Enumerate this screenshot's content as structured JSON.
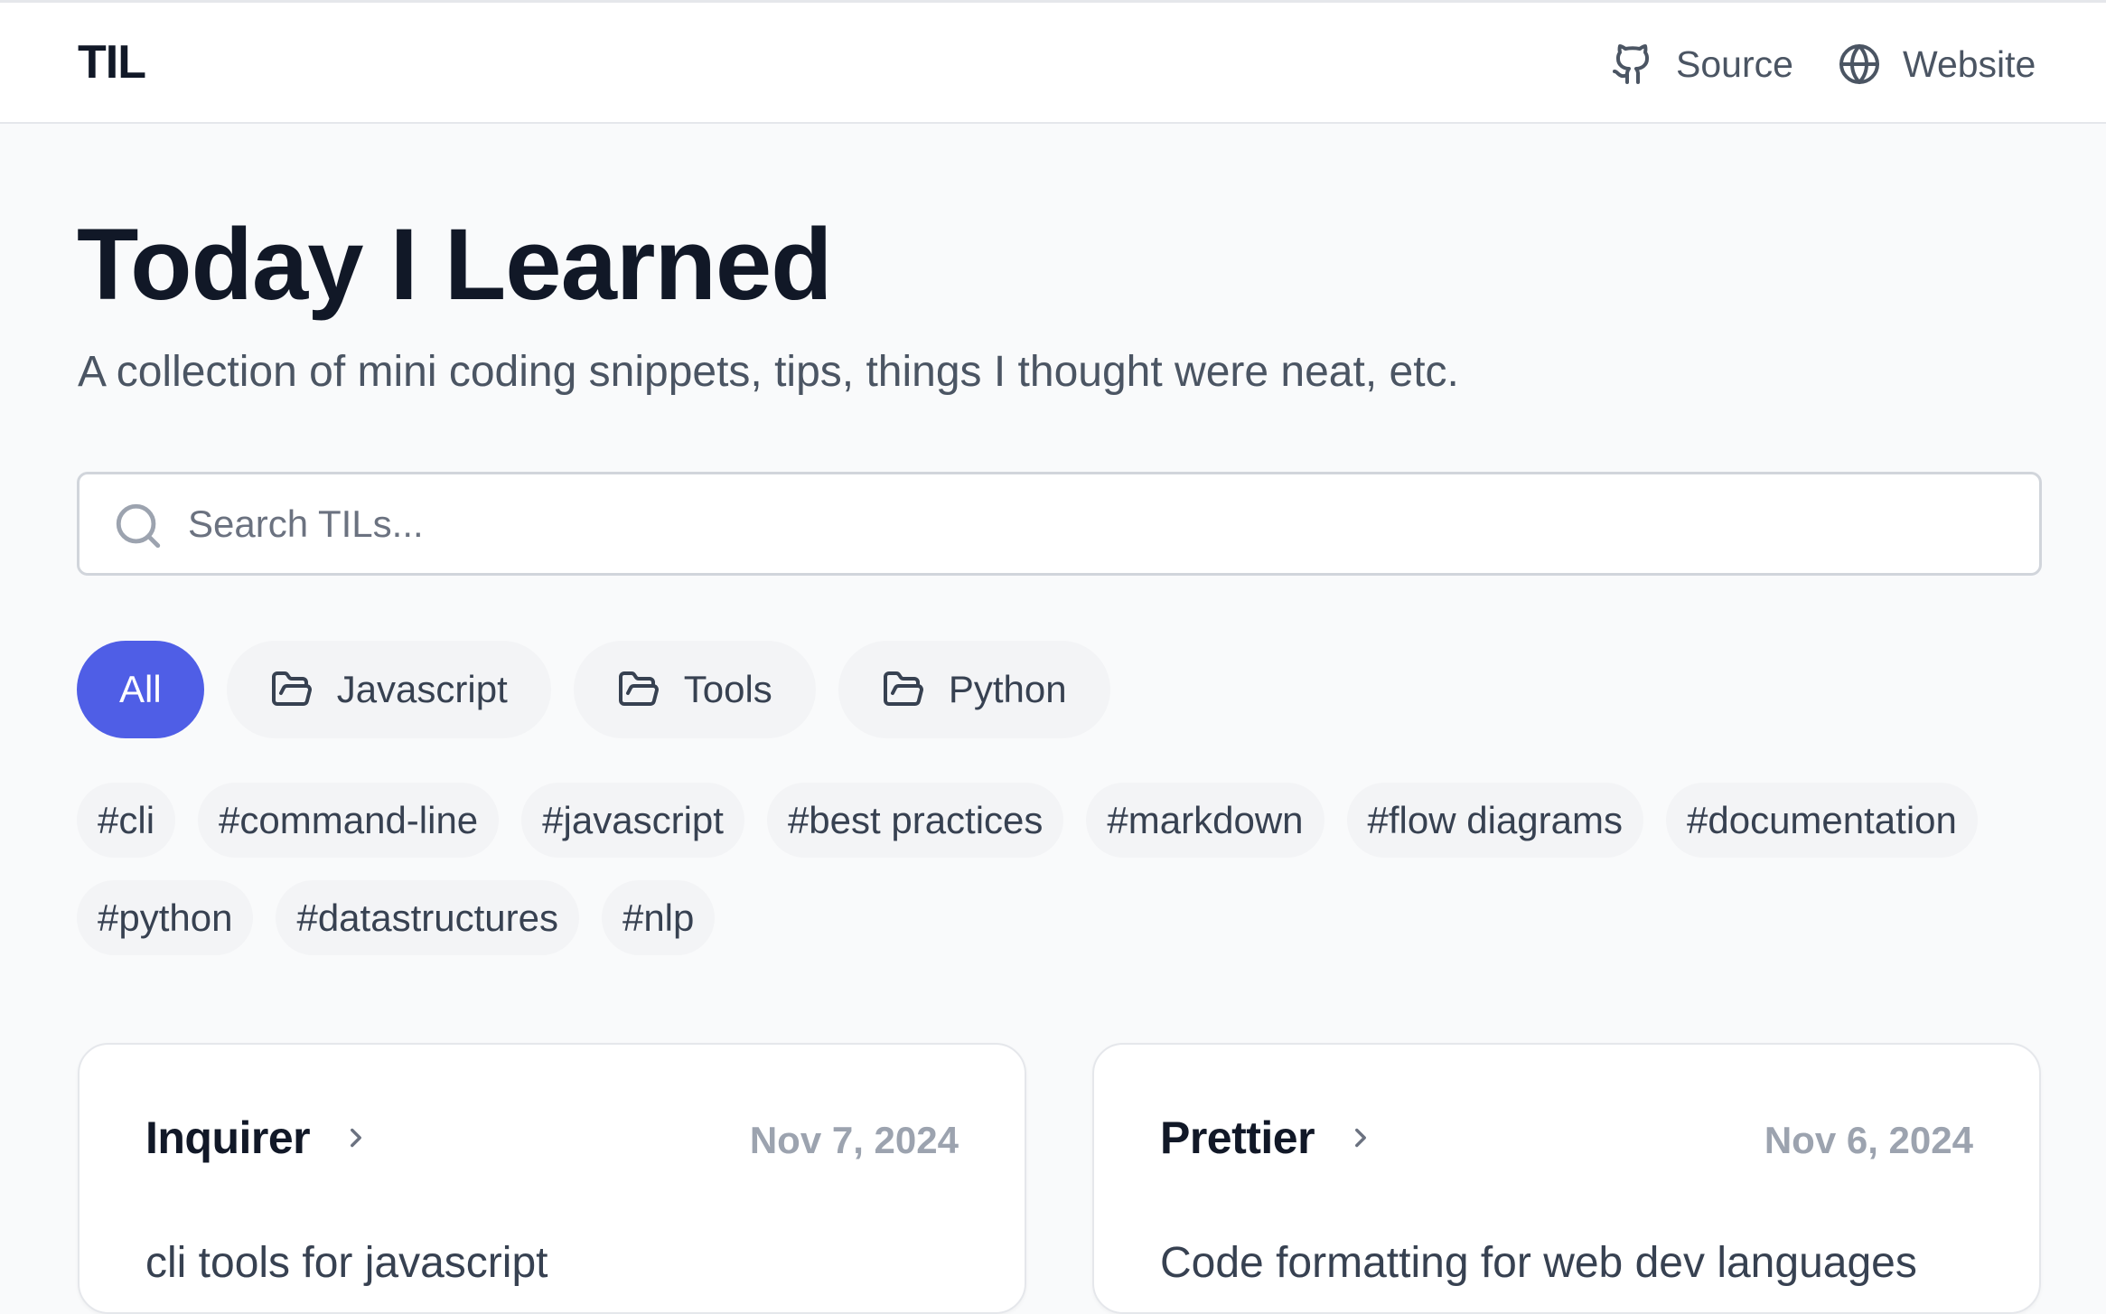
{
  "header": {
    "brand": "TIL",
    "links": [
      {
        "label": "Source",
        "icon": "github-icon"
      },
      {
        "label": "Website",
        "icon": "globe-icon"
      }
    ]
  },
  "hero": {
    "title": "Today I Learned",
    "subtitle": "A collection of mini coding snippets, tips, things I thought were neat, etc."
  },
  "search": {
    "placeholder": "Search TILs...",
    "value": ""
  },
  "categories": [
    {
      "label": "All",
      "active": true
    },
    {
      "label": "Javascript",
      "icon": "folder-icon"
    },
    {
      "label": "Tools",
      "icon": "folder-icon"
    },
    {
      "label": "Python",
      "icon": "folder-icon"
    }
  ],
  "tags": [
    "#cli",
    "#command-line",
    "#javascript",
    "#best practices",
    "#markdown",
    "#flow diagrams",
    "#documentation",
    "#python",
    "#datastructures",
    "#nlp"
  ],
  "cards": [
    {
      "title": "Inquirer",
      "date": "Nov 7, 2024",
      "description": "cli tools for javascript"
    },
    {
      "title": "Prettier",
      "date": "Nov 6, 2024",
      "description": "Code formatting for web dev languages"
    }
  ],
  "colors": {
    "accent": "#4f5ee6",
    "background": "#f9fafb",
    "chip": "#f3f4f6",
    "text_primary": "#111827",
    "text_secondary": "#4b5563",
    "date": "#9ca3af"
  }
}
